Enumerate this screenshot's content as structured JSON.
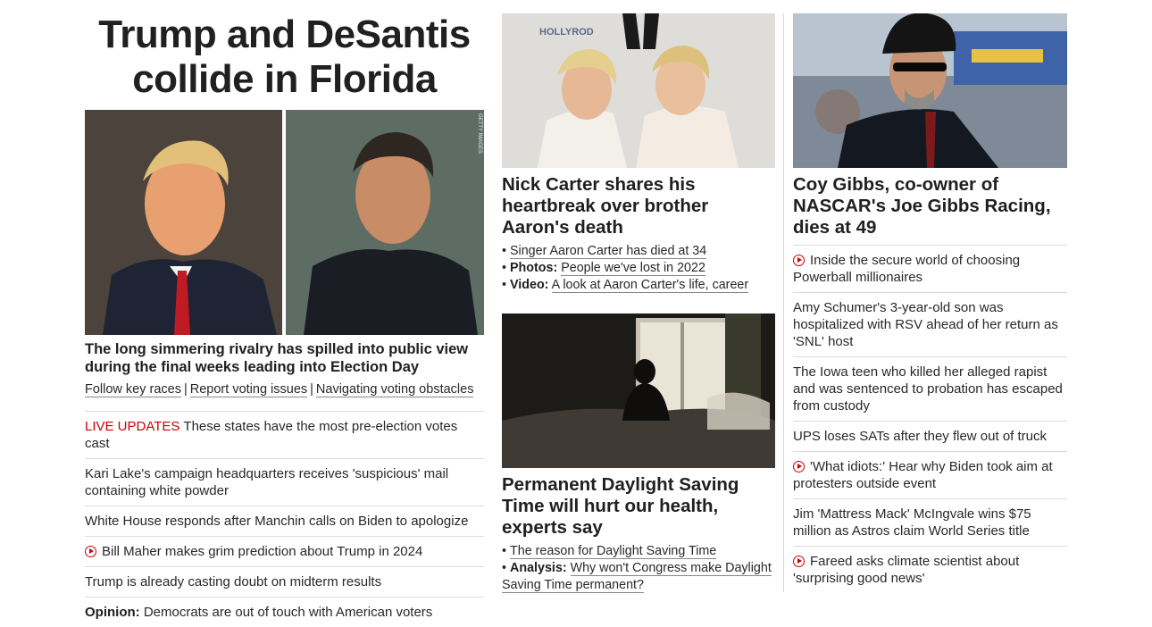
{
  "lead": {
    "headline": "Trump and DeSantis collide in Florida",
    "photo_credit": "GETTY IMAGES",
    "subhead": "The long simmering rivalry has spilled into public view during the final weeks leading into Election Day",
    "links": [
      "Follow key races",
      "Report voting issues",
      "Navigating voting obstacles"
    ],
    "stories": [
      {
        "prefix": "LIVE UPDATES",
        "text": "These states have the most pre-election votes cast"
      },
      {
        "text": "Kari Lake's campaign headquarters receives 'suspicious' mail containing white powder"
      },
      {
        "text": "White House responds after Manchin calls on Biden to apologize"
      },
      {
        "video": true,
        "text": "Bill Maher makes grim prediction about Trump in 2024"
      },
      {
        "text": "Trump is already casting doubt on midterm results"
      },
      {
        "prefix": "Opinion:",
        "text": "Democrats are out of touch with American voters"
      }
    ]
  },
  "middle": {
    "card1": {
      "image_text": "HOLLYROD",
      "title": "Nick Carter shares his heartbreak over brother Aaron's death",
      "bullets": [
        {
          "label": "",
          "text": "Singer Aaron Carter has died at 34"
        },
        {
          "label": "Photos:",
          "text": "People we've lost in 2022"
        },
        {
          "label": "Video:",
          "text": "A look at Aaron Carter's life, career"
        }
      ]
    },
    "card2": {
      "title": "Permanent Daylight Saving Time will hurt our health, experts say",
      "bullets": [
        {
          "label": "",
          "text": "The reason for Daylight Saving Time"
        },
        {
          "label": "Analysis:",
          "text": "Why won't Congress make Daylight Saving Time permanent?"
        }
      ]
    }
  },
  "right": {
    "title": "Coy Gibbs, co-owner of NASCAR's Joe Gibbs Racing, dies at 49",
    "stories": [
      {
        "video": true,
        "text": "Inside the secure world of choosing Powerball millionaires"
      },
      {
        "text": "Amy Schumer's 3-year-old son was hospitalized with RSV ahead of her return as 'SNL' host"
      },
      {
        "text": "The Iowa teen who killed her alleged rapist and was sentenced to probation has escaped from custody"
      },
      {
        "text": "UPS loses SATs after they flew out of truck"
      },
      {
        "video": true,
        "text": "'What idiots:' Hear why Biden took aim at protesters outside event"
      },
      {
        "text": "Jim 'Mattress Mack' McIngvale wins $75 million as Astros claim World Series title"
      },
      {
        "video": true,
        "text": "Fareed asks climate scientist about 'surprising good news'"
      }
    ]
  },
  "colors": {
    "accent_red": "#cc0000",
    "text": "#282828",
    "divider": "#dcdcdc"
  }
}
